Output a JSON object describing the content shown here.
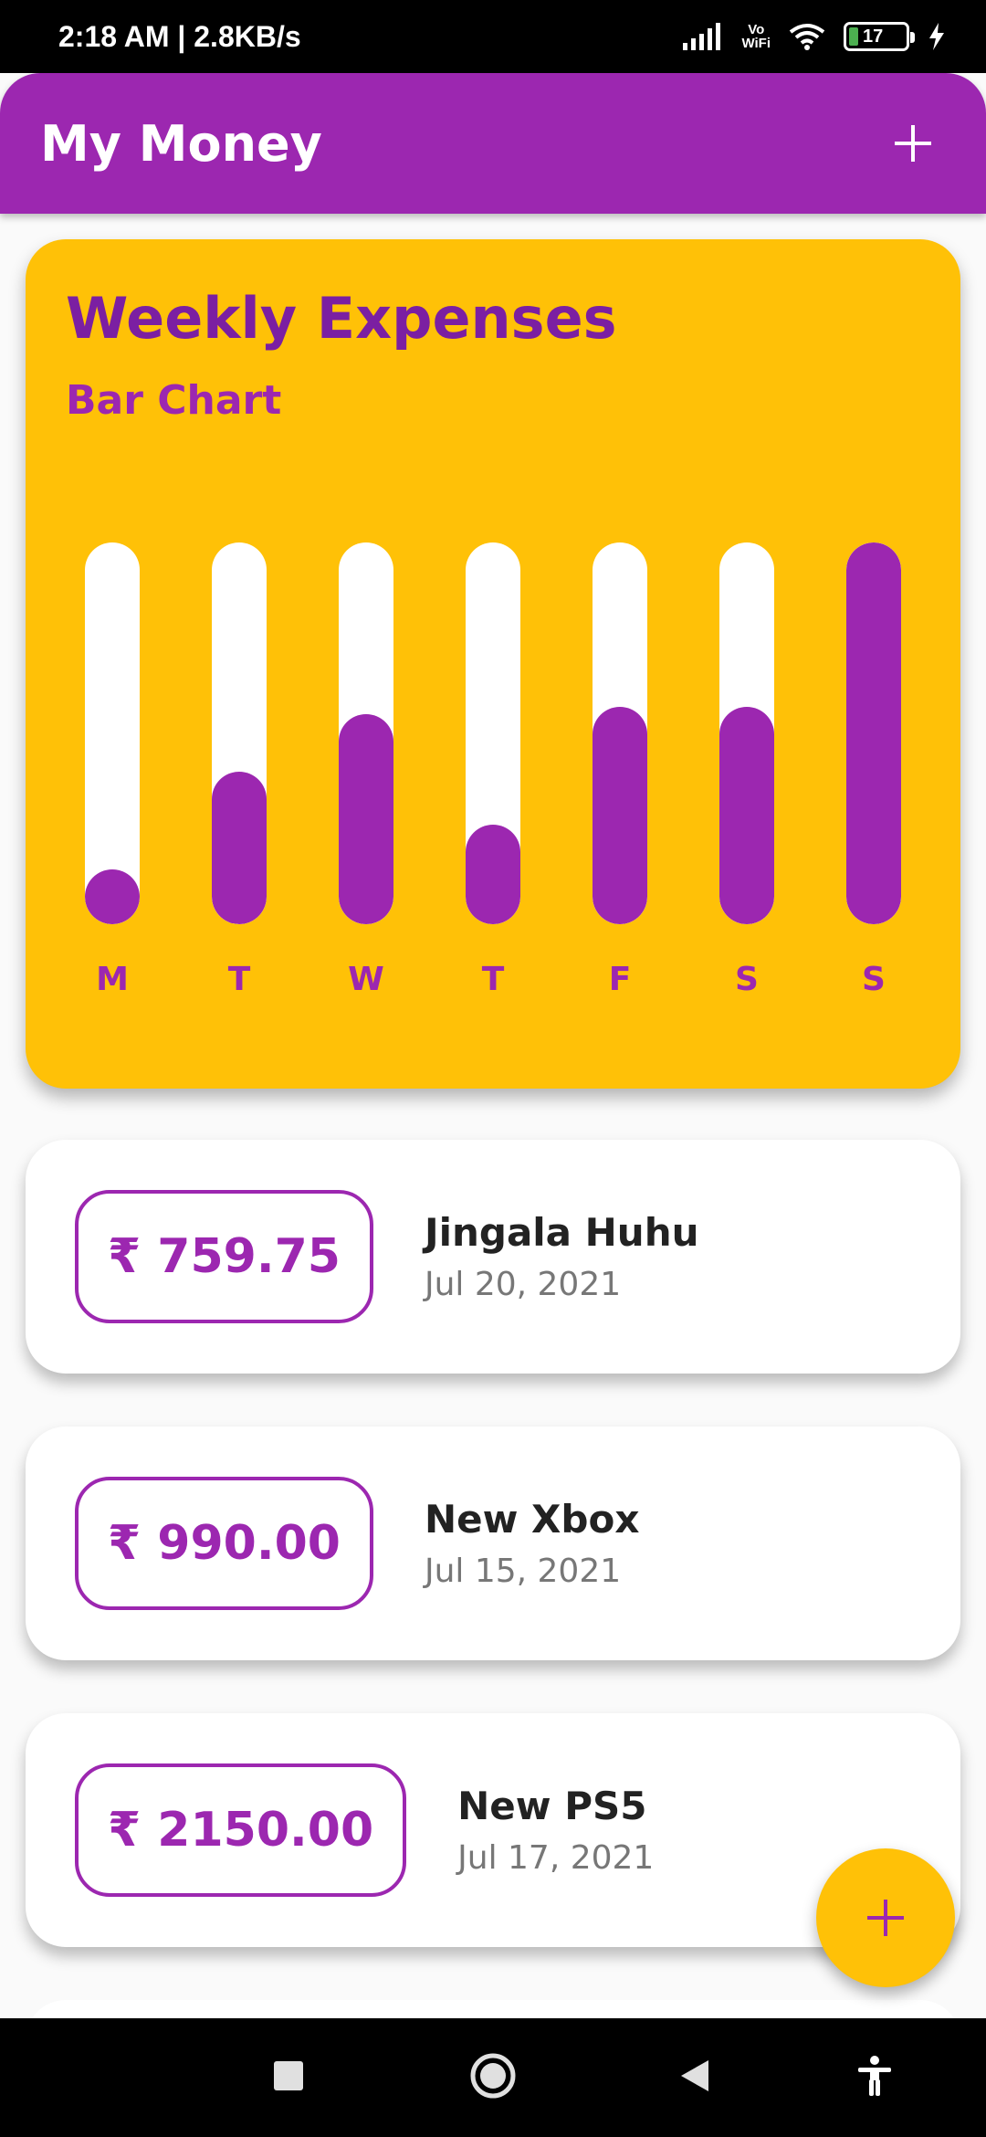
{
  "status_bar": {
    "time_speed": "2:18 AM | 2.8KB/s",
    "vowifi": [
      "Vo",
      "WiFi"
    ],
    "battery": "17"
  },
  "app_bar": {
    "title": "My Money",
    "add_icon": "plus-icon",
    "add_label": "+"
  },
  "chart_card": {
    "title": "Weekly Expenses",
    "subtitle": "Bar Chart",
    "colors": {
      "background": "#ffc107",
      "bar": "#9c27b0",
      "track": "#ffffff"
    }
  },
  "chart_data": {
    "type": "bar",
    "title": "Weekly Expenses",
    "subtitle": "Bar Chart",
    "categories": [
      "M",
      "T",
      "W",
      "T",
      "F",
      "S",
      "S"
    ],
    "values": [
      0.14,
      0.4,
      0.55,
      0.26,
      0.57,
      0.57,
      1.0
    ],
    "ylim": [
      0,
      1
    ],
    "grid": false
  },
  "transactions": [
    {
      "amount": "₹ 759.75",
      "title": "Jingala Huhu",
      "date": "Jul 20, 2021"
    },
    {
      "amount": "₹ 990.00",
      "title": "New Xbox",
      "date": "Jul 15, 2021"
    },
    {
      "amount": "₹ 2150.00",
      "title": "New PS5",
      "date": "Jul 17, 2021"
    }
  ],
  "fab": {
    "icon": "plus-icon",
    "label": "+"
  },
  "nav_bar": {
    "icons": [
      "recents-square-icon",
      "home-circle-icon",
      "back-triangle-icon",
      "accessibility-icon"
    ]
  }
}
